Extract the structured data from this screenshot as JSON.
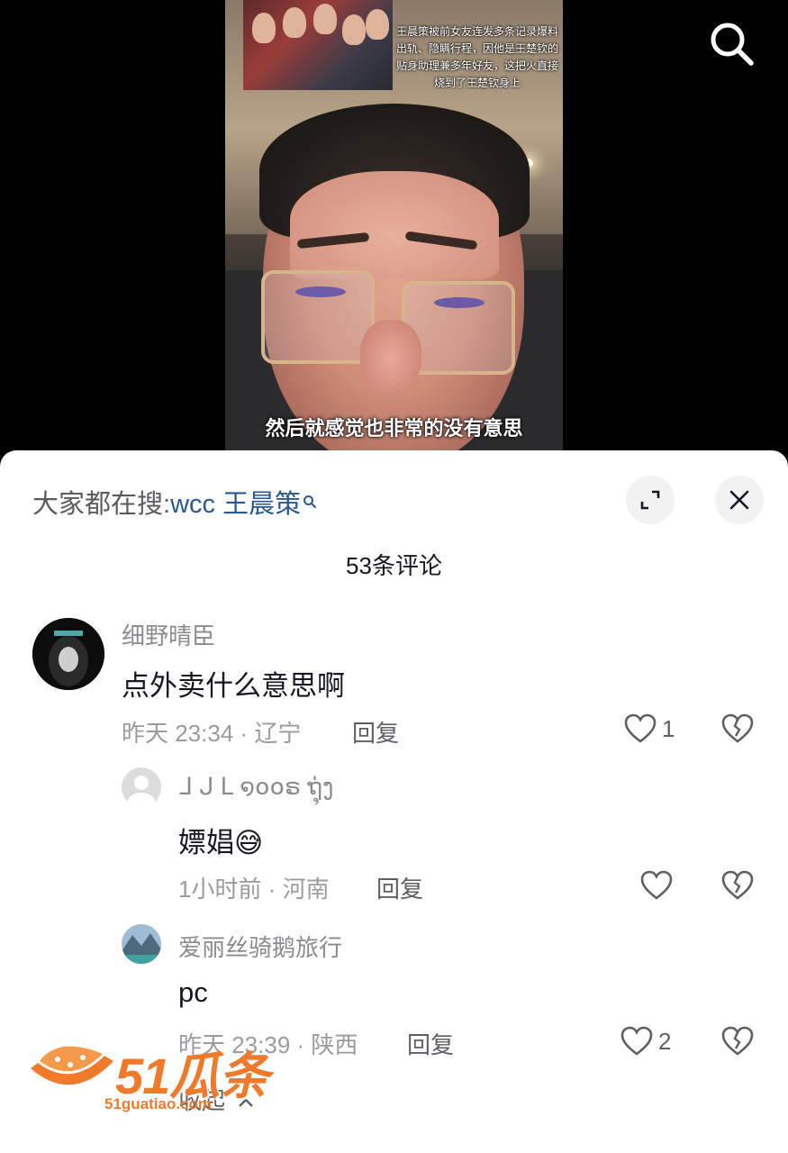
{
  "video": {
    "inset_caption": "王晨策被前女友连发多条记录爆料出轨、隐瞒行程，因他是王楚钦的贴身助理兼多年好友，这把火直接烧到了王楚钦身上",
    "subtitle": "然后就感觉也非常的没有意思"
  },
  "top_bar": {
    "search_icon": "search-icon"
  },
  "sheet": {
    "hot_search_prefix": "大家都在搜:",
    "hot_search_term": "wcc 王晨策",
    "expand_icon": "expand-icon",
    "close_icon": "close-icon",
    "comment_count": "53条评论"
  },
  "comments": [
    {
      "username": "细野晴臣",
      "text": "点外卖什么意思啊",
      "meta": "昨天 23:34 · 辽宁",
      "reply_label": "回复",
      "likes": "1",
      "replies": [
        {
          "username": "ᒧ ᒍ ᒪ ໑໐໐ຣ ຖຸ່ງ",
          "text": "嫖娼",
          "emoji": "😅",
          "meta": "1小时前 · 河南",
          "reply_label": "回复",
          "likes": ""
        },
        {
          "username": "爱丽丝骑鹅旅行",
          "text": "pc",
          "meta": "昨天 23:39 · 陕西",
          "reply_label": "回复",
          "likes": "2"
        }
      ],
      "collapse_label": "收起"
    }
  ],
  "watermark": {
    "brand": "51瓜条",
    "url": "51guatiao.com"
  },
  "colors": {
    "accent_link": "#285a92",
    "watermark": "#f07a2a"
  }
}
